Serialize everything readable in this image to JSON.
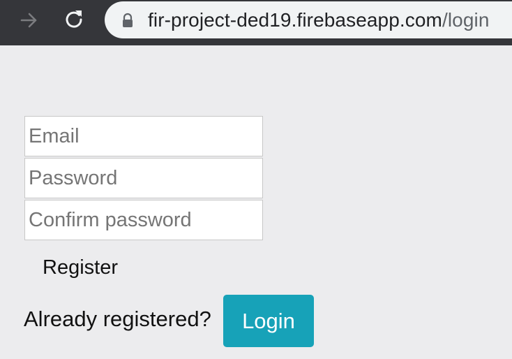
{
  "browser": {
    "url_host": "fir-project-ded19.firebaseapp.com",
    "url_path": "/login",
    "icons": {
      "forward": "arrow-right-icon",
      "reload": "reload-icon",
      "lock": "lock-icon"
    }
  },
  "form": {
    "email_placeholder": "Email",
    "password_placeholder": "Password",
    "confirm_placeholder": "Confirm password",
    "register_label": "Register",
    "already_text": "Already registered?",
    "login_label": "Login"
  },
  "colors": {
    "login_button": "#17a2b8",
    "page_background": "#ececee",
    "browser_bar": "#35363a"
  }
}
